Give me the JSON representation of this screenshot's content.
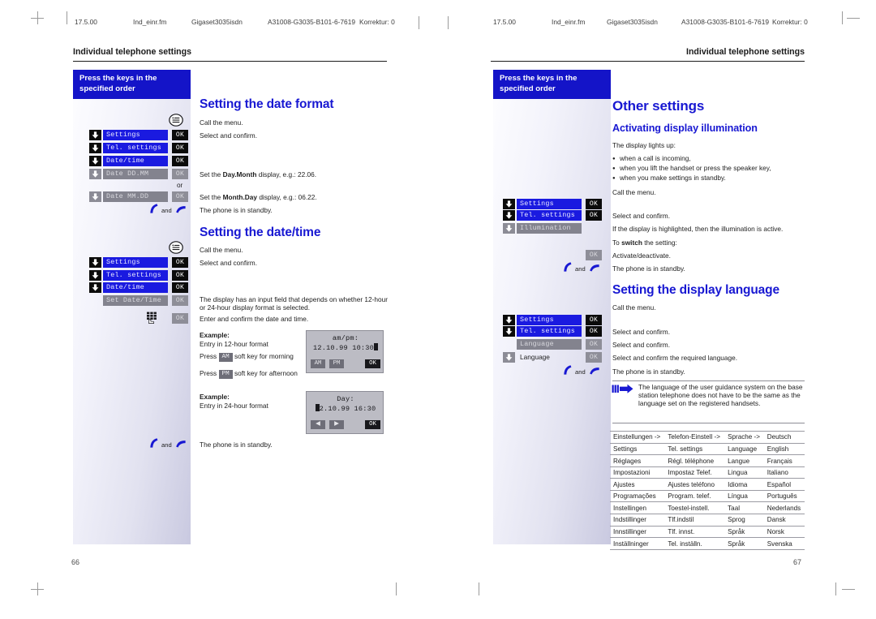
{
  "document": {
    "running_header": {
      "version": "17.5.00",
      "file": "Ind_einr.fm",
      "product": "Gigaset3035isdn",
      "docnum": "A31008-G3035-B101-6-7619",
      "revision": "Korrektur: 0"
    },
    "chapter_title": "Individual telephone settings",
    "sidebar_note": "Press the keys in the\nspecified order",
    "sidebar_note_line1": "Press the keys in the",
    "sidebar_note_line2": "specified order",
    "page_left": "66",
    "page_right": "67"
  },
  "left_page": {
    "sections": [
      {
        "heading": "Setting the date format",
        "steps": [
          {
            "icon": "menu-key-icon",
            "text": "Call the menu."
          },
          {
            "arrow": true,
            "lcd": "Settings",
            "ok": "OK",
            "text": "Select and confirm."
          },
          {
            "arrow": true,
            "lcd": "Tel. settings",
            "ok": "OK",
            "text": ""
          },
          {
            "arrow": true,
            "lcd": "Date/time",
            "ok": "OK",
            "text": ""
          },
          {
            "arrow": true,
            "dim": true,
            "lcd": "Date DD.MM",
            "ok": "OK",
            "text_html": "Set the <b>Day.Month</b> display, e.g.: 22.06."
          },
          {
            "or": "or"
          },
          {
            "arrow": true,
            "dim": true,
            "lcd": "Date MM.DD",
            "ok": "OK",
            "text_html": "Set the <b>Month.Day</b> display, e.g.: 06.22."
          },
          {
            "icon": "handset-lift-hangup-icon",
            "and": "and",
            "text": "The phone is in standby."
          }
        ]
      },
      {
        "heading": "Setting the date/time",
        "steps": [
          {
            "icon": "menu-key-icon",
            "text": "Call the menu."
          },
          {
            "arrow": true,
            "lcd": "Settings",
            "ok": "OK",
            "text": "Select and confirm."
          },
          {
            "arrow": true,
            "lcd": "Tel. settings",
            "ok": "OK",
            "text": ""
          },
          {
            "arrow": true,
            "lcd": "Date/time",
            "ok": "OK",
            "text": ""
          },
          {
            "dim": true,
            "lcd": "Set Date/Time",
            "ok": "OK",
            "text": "The display has an input field that depends on whether 12-hour or 24-hour display format is selected."
          },
          {
            "icon": "keypad-icon",
            "ok": "OK",
            "text": "Enter and confirm the date and time."
          }
        ]
      }
    ],
    "examples": [
      {
        "label": "Example:",
        "desc": "Entry in 12-hour format",
        "press_before_1": "Press",
        "key_1": "AM",
        "press_after_1": "soft key for morning",
        "press_before_2": "Press",
        "key_2": "PM",
        "press_after_2": "soft key for afternoon",
        "display": {
          "line1": "am/pm:",
          "line2": "12.10.99 10:30",
          "softkeys": [
            "AM",
            "PM"
          ],
          "ok": "OK"
        }
      },
      {
        "label": "Example:",
        "desc": "Entry in 24-hour format",
        "display": {
          "line1": "Day:",
          "line2": "2.10.99  16:30",
          "softkeys": [
            "◀",
            "▶"
          ],
          "ok": "OK"
        }
      }
    ],
    "standby_text": "The phone is in standby.",
    "standby_and": "and"
  },
  "right_page": {
    "title": "Other settings",
    "sections": [
      {
        "heading": "Activating display illumination",
        "intro": "The display lights up:",
        "bullets": [
          "when a call is incoming,",
          "when you lift the handset or press the speaker key,",
          "when you make settings in standby."
        ],
        "steps": [
          {
            "icon": "menu-key-icon",
            "text": "Call the menu."
          },
          {
            "arrow": true,
            "lcd": "Settings",
            "ok": "OK",
            "text": ""
          },
          {
            "arrow": true,
            "lcd": "Tel. settings",
            "ok": "OK",
            "text": "Select and confirm."
          },
          {
            "arrow": true,
            "dim": true,
            "lcd": "Illumination",
            "text": "If the display is highlighted, then the illumination is active."
          },
          {
            "text_html": "To <b>switch</b> the setting:"
          },
          {
            "ok": "OK",
            "dim": true,
            "text": "Activate/deactivate."
          },
          {
            "icon": "handset-lift-hangup-icon",
            "and": "and",
            "text": "The phone is in standby."
          }
        ]
      },
      {
        "heading": "Setting the display language",
        "steps": [
          {
            "icon": "menu-key-icon",
            "text": "Call the menu."
          },
          {
            "arrow": true,
            "lcd": "Settings",
            "ok": "OK",
            "text": ""
          },
          {
            "arrow": true,
            "lcd": "Tel. settings",
            "ok": "OK",
            "text": "Select and confirm."
          },
          {
            "dim": true,
            "lcd": "Language",
            "ok": "OK",
            "text": "Select and confirm."
          },
          {
            "arrow": true,
            "dim": true,
            "lcd_plain": "Language",
            "ok": "OK",
            "text": "Select and confirm the required language."
          },
          {
            "icon": "handset-lift-hangup-icon",
            "and": "and",
            "text": "The phone is in standby."
          }
        ]
      }
    ],
    "note": {
      "icon": "note-arrow-icon",
      "text": "The language of the user guidance system on the base station telephone does not have to be the same as the language set on the registered handsets."
    },
    "language_table": {
      "rows": [
        [
          "Einstellungen  ->",
          "Telefon-Einstell ->",
          "Sprache ->",
          "Deutsch"
        ],
        [
          "Settings",
          "Tel. settings",
          "Language",
          "English"
        ],
        [
          "Réglages",
          "Régl. téléphone",
          "Langue",
          "Français"
        ],
        [
          "Impostazioni",
          "Impostaz Telef.",
          "Lingua",
          "Italiano"
        ],
        [
          "Ajustes",
          "Ajustes teléfono",
          "Idioma",
          "Español"
        ],
        [
          "Programações",
          "Program. telef.",
          "Língua",
          "Português"
        ],
        [
          "Instellingen",
          "Toestel-instell.",
          "Taal",
          "Nederlands"
        ],
        [
          "Indstillinger",
          "Tlf.indstil",
          "Sprog",
          "Dansk"
        ],
        [
          "Innstillinger",
          "Tlf. innst.",
          "Språk",
          "Norsk"
        ],
        [
          "Inställninger",
          "Tel. inställn.",
          "Språk",
          "Svenska"
        ]
      ]
    }
  },
  "colors": {
    "brand_blue": "#1818d2",
    "lcd_blue": "#1a1ae0",
    "lcd_gray": "#83838e",
    "key_black": "#0b0b0b",
    "key_gray": "#8e8e98"
  }
}
